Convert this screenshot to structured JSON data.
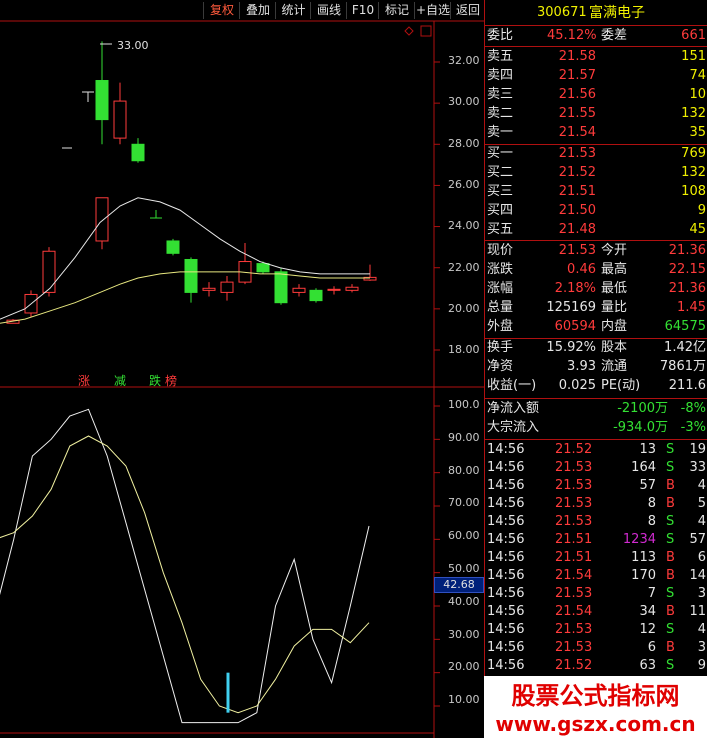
{
  "toolbar": {
    "buttons": [
      "复权",
      "叠加",
      "统计",
      "画线",
      "F10",
      "标记",
      "+自选",
      "返回"
    ],
    "active_index": 0
  },
  "stock": {
    "code": "300671",
    "name": "富满电子"
  },
  "orderbook": {
    "weibi_label": "委比",
    "weibi_value": "45.12%",
    "weicha_label": "委差",
    "weicha_value": "661",
    "sells": [
      {
        "label": "卖五",
        "price": "21.58",
        "vol": "151"
      },
      {
        "label": "卖四",
        "price": "21.57",
        "vol": "74"
      },
      {
        "label": "卖三",
        "price": "21.56",
        "vol": "10"
      },
      {
        "label": "卖二",
        "price": "21.55",
        "vol": "132"
      },
      {
        "label": "卖一",
        "price": "21.54",
        "vol": "35"
      }
    ],
    "buys": [
      {
        "label": "买一",
        "price": "21.53",
        "vol": "769"
      },
      {
        "label": "买二",
        "price": "21.52",
        "vol": "132"
      },
      {
        "label": "买三",
        "price": "21.51",
        "vol": "108"
      },
      {
        "label": "买四",
        "price": "21.50",
        "vol": "9"
      },
      {
        "label": "买五",
        "price": "21.48",
        "vol": "45"
      }
    ]
  },
  "quote": [
    {
      "l1": "现价",
      "v1": "21.53",
      "c1": "red",
      "l2": "今开",
      "v2": "21.36",
      "c2": "red"
    },
    {
      "l1": "涨跌",
      "v1": "0.46",
      "c1": "red",
      "l2": "最高",
      "v2": "22.15",
      "c2": "red"
    },
    {
      "l1": "涨幅",
      "v1": "2.18%",
      "c1": "red",
      "l2": "最低",
      "v2": "21.36",
      "c2": "red"
    },
    {
      "l1": "总量",
      "v1": "125169",
      "c1": "white",
      "l2": "量比",
      "v2": "1.45",
      "c2": "red"
    },
    {
      "l1": "外盘",
      "v1": "60594",
      "c1": "red",
      "l2": "内盘",
      "v2": "64575",
      "c2": "green"
    }
  ],
  "stats": [
    {
      "l1": "换手",
      "v1": "15.92%",
      "l2": "股本",
      "v2": "1.42亿"
    },
    {
      "l1": "净资",
      "v1": "3.93",
      "l2": "流通",
      "v2": "7861万"
    },
    {
      "l1": "收益(一)",
      "v1": "0.025",
      "l2": "PE(动)",
      "v2": "211.6"
    }
  ],
  "flows": [
    {
      "label": "净流入额",
      "value": "-2100万",
      "pct": "-8%"
    },
    {
      "label": "大宗流入",
      "value": "-934.0万",
      "pct": "-3%"
    }
  ],
  "ticks": [
    {
      "t": "14:56",
      "p": "21.52",
      "v": "13",
      "s": "S",
      "n": "19",
      "pc": "red",
      "vc": "white"
    },
    {
      "t": "14:56",
      "p": "21.53",
      "v": "164",
      "s": "S",
      "n": "33",
      "pc": "red",
      "vc": "white"
    },
    {
      "t": "14:56",
      "p": "21.53",
      "v": "57",
      "s": "B",
      "n": "4",
      "pc": "red",
      "vc": "white"
    },
    {
      "t": "14:56",
      "p": "21.53",
      "v": "8",
      "s": "B",
      "n": "5",
      "pc": "red",
      "vc": "white"
    },
    {
      "t": "14:56",
      "p": "21.53",
      "v": "8",
      "s": "S",
      "n": "4",
      "pc": "red",
      "vc": "white"
    },
    {
      "t": "14:56",
      "p": "21.51",
      "v": "1234",
      "s": "S",
      "n": "57",
      "pc": "red",
      "vc": "magenta"
    },
    {
      "t": "14:56",
      "p": "21.51",
      "v": "113",
      "s": "B",
      "n": "6",
      "pc": "red",
      "vc": "white"
    },
    {
      "t": "14:56",
      "p": "21.54",
      "v": "170",
      "s": "B",
      "n": "14",
      "pc": "red",
      "vc": "white"
    },
    {
      "t": "14:56",
      "p": "21.53",
      "v": "7",
      "s": "S",
      "n": "3",
      "pc": "red",
      "vc": "white"
    },
    {
      "t": "14:56",
      "p": "21.54",
      "v": "34",
      "s": "B",
      "n": "11",
      "pc": "red",
      "vc": "white"
    },
    {
      "t": "14:56",
      "p": "21.53",
      "v": "12",
      "s": "S",
      "n": "4",
      "pc": "red",
      "vc": "white"
    },
    {
      "t": "14:56",
      "p": "21.53",
      "v": "6",
      "s": "B",
      "n": "3",
      "pc": "red",
      "vc": "white"
    },
    {
      "t": "14:56",
      "p": "21.52",
      "v": "63",
      "s": "S",
      "n": "9",
      "pc": "red",
      "vc": "white"
    }
  ],
  "price_axis": [
    "32.00",
    "30.00",
    "28.00",
    "26.00",
    "24.00",
    "22.00",
    "20.00",
    "18.00"
  ],
  "osc_axis": [
    "100.0",
    "90.00",
    "80.00",
    "70.00",
    "60.00",
    "50.00",
    "40.00",
    "30.00",
    "20.00",
    "10.00"
  ],
  "osc_current": "42.68",
  "high_label": "33.00",
  "indicator_labels": [
    "涨",
    "减",
    "跌",
    "榜"
  ],
  "watermark": {
    "line1": "股票公式指标网",
    "line2": "www.gszx.com.cn"
  },
  "colors": {
    "up": "#ff3b3b",
    "down": "#33e033",
    "grid": "#b01010"
  },
  "candles": [
    {
      "o": 19.3,
      "c": 19.45,
      "h": 19.5,
      "l": 19.3
    },
    {
      "o": 19.8,
      "c": 20.7,
      "h": 20.9,
      "l": 19.6
    },
    {
      "o": 20.8,
      "c": 22.8,
      "h": 23.0,
      "l": 20.6
    },
    {
      "o": 23.3,
      "c": 25.4,
      "h": 25.4,
      "l": 22.9
    },
    {
      "o": 31.1,
      "c": 29.2,
      "h": 33.0,
      "l": 28.0
    },
    {
      "o": 28.3,
      "c": 30.1,
      "h": 31.0,
      "l": 28.0
    },
    {
      "o": 28.0,
      "c": 27.2,
      "h": 28.3,
      "l": 27.1
    },
    {
      "o": 23.3,
      "c": 22.7,
      "h": 23.4,
      "l": 22.6
    },
    {
      "o": 22.4,
      "c": 20.8,
      "h": 22.5,
      "l": 20.3
    },
    {
      "o": 20.9,
      "c": 21.0,
      "h": 21.3,
      "l": 20.6
    },
    {
      "o": 20.8,
      "c": 21.3,
      "h": 21.6,
      "l": 20.4
    },
    {
      "o": 21.3,
      "c": 22.3,
      "h": 23.2,
      "l": 21.2
    },
    {
      "o": 22.2,
      "c": 21.8,
      "h": 22.3,
      "l": 21.7
    },
    {
      "o": 21.8,
      "c": 20.3,
      "h": 22.0,
      "l": 20.2
    },
    {
      "o": 20.8,
      "c": 21.0,
      "h": 21.2,
      "l": 20.6
    },
    {
      "o": 20.9,
      "c": 20.4,
      "h": 21.0,
      "l": 20.3
    },
    {
      "o": 20.9,
      "c": 20.95,
      "h": 21.1,
      "l": 20.7
    },
    {
      "o": 20.9,
      "c": 21.05,
      "h": 21.2,
      "l": 20.8
    },
    {
      "o": 21.4,
      "c": 21.53,
      "h": 22.15,
      "l": 21.36
    }
  ],
  "osc_series_white": [
    38,
    60,
    85,
    90,
    97,
    99,
    85,
    65,
    45,
    25,
    5,
    5,
    5,
    5,
    8,
    40,
    54,
    30,
    17,
    40,
    64
  ],
  "osc_series_yellow": [
    60,
    62,
    67,
    75,
    88,
    91,
    88,
    82,
    68,
    50,
    35,
    18,
    10,
    8,
    10,
    18,
    28,
    33,
    33,
    29,
    35
  ]
}
